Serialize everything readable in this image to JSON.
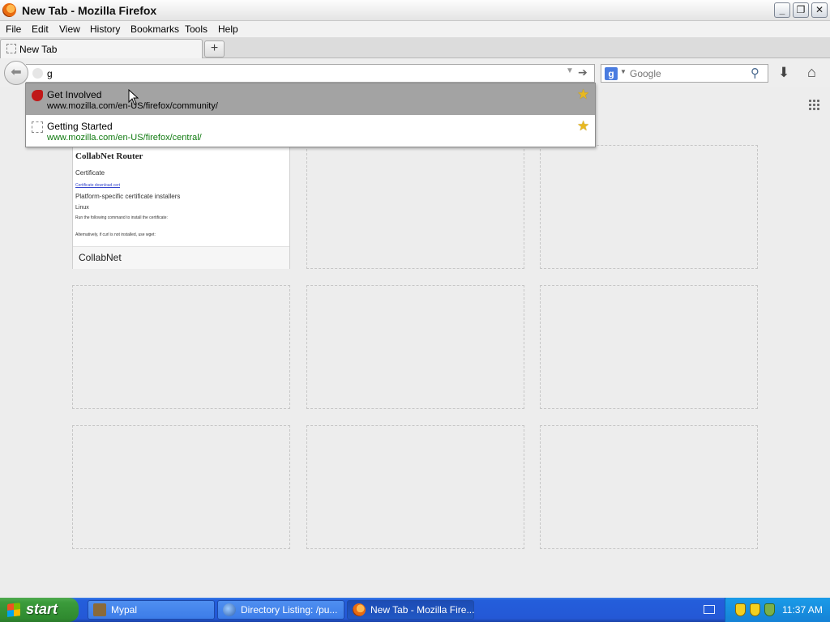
{
  "window": {
    "title": "New Tab - Mozilla Firefox"
  },
  "menu": [
    "File",
    "Edit",
    "View",
    "History",
    "Bookmarks",
    "Tools",
    "Help"
  ],
  "tabs": [
    {
      "label": "New Tab"
    }
  ],
  "urlbar": {
    "value": "g"
  },
  "search": {
    "placeholder": "Google",
    "engine_badge": "g"
  },
  "autocomplete": [
    {
      "title": "Get Involved",
      "url": "www.mozilla.com/en-US/firefox/community/",
      "selected": true
    },
    {
      "title": "Getting Started",
      "url": "www.mozilla.com/en-US/firefox/central/",
      "selected": false
    }
  ],
  "tiles": [
    {
      "title": "CollabNet",
      "thumbnail": {
        "heading": "CollabNet Router",
        "line1": "Certificate",
        "link": "Certificate download.cert",
        "line2": "Platform-specific certificate installers",
        "line3": "Linux",
        "line4": "Run the following command to install the certificate:",
        "line5": "Alternatively, if curl is not installed, use wget:"
      }
    }
  ],
  "taskbar": {
    "start_label": "start",
    "items": [
      {
        "label": "Mypal"
      },
      {
        "label": "Directory Listing: /pu..."
      },
      {
        "label": "New Tab - Mozilla Fire..."
      }
    ],
    "clock": "11:37 AM"
  }
}
